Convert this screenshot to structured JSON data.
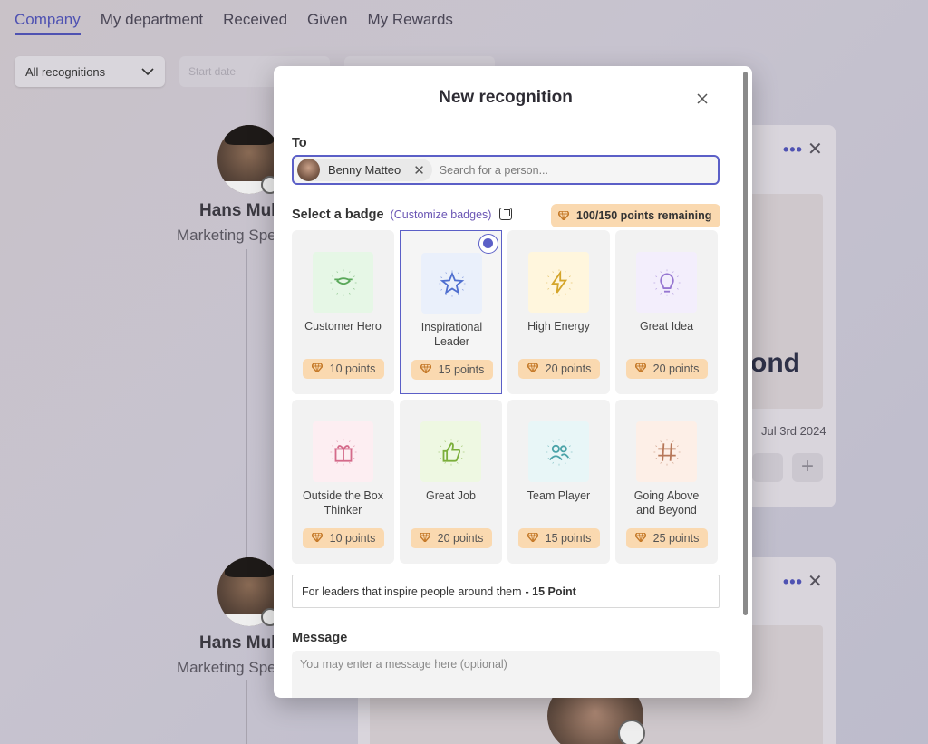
{
  "nav": {
    "tabs": [
      "Company",
      "My department",
      "Received",
      "Given",
      "My Rewards"
    ],
    "active_tab": "Company"
  },
  "filters": {
    "recognition_select": "All recognitions",
    "start_date_placeholder": "Start date"
  },
  "background_feed": {
    "people": [
      {
        "name": "Hans Mul",
        "role": "Marketing Spe"
      },
      {
        "name": "Hans Mul",
        "role": "Marketing Spe"
      }
    ],
    "card_date": "Jul 3rd 2024",
    "card_banner_fragment": "ond"
  },
  "modal": {
    "title": "New recognition",
    "to_label": "To",
    "recipient_chip": "Benny Matteo",
    "search_placeholder": "Search for a person...",
    "select_badge_label": "Select a badge",
    "customize_link": "(Customize badges)",
    "points_remaining": "100/150 points remaining",
    "badges": [
      {
        "name": "Customer Hero",
        "name2": "",
        "points": "10 points",
        "icon": "handshake-icon",
        "bg": "#e6f7e6",
        "color": "#5aa85a"
      },
      {
        "name": "Inspirational",
        "name2": "Leader",
        "points": "15 points",
        "icon": "star-icon",
        "bg": "#eaf0fb",
        "color": "#4f6fcf",
        "selected": true
      },
      {
        "name": "High Energy",
        "name2": "",
        "points": "20 points",
        "icon": "lightning-icon",
        "bg": "#fff6dd",
        "color": "#d4a52a"
      },
      {
        "name": "Great Idea",
        "name2": "",
        "points": "20 points",
        "icon": "lightbulb-icon",
        "bg": "#f3eefc",
        "color": "#9676d1"
      },
      {
        "name": "Outside the Box",
        "name2": "Thinker",
        "points": "10 points",
        "icon": "gift-box-icon",
        "bg": "#fdeef2",
        "color": "#d46a8a"
      },
      {
        "name": "Great Job",
        "name2": "",
        "points": "20 points",
        "icon": "thumbs-up-icon",
        "bg": "#eef8e2",
        "color": "#7caf3c"
      },
      {
        "name": "Team Player",
        "name2": "",
        "points": "15 points",
        "icon": "people-icon",
        "bg": "#e8f6f7",
        "color": "#4aa3a8"
      },
      {
        "name": "Going Above",
        "name2": "and Beyond",
        "points": "25 points",
        "icon": "hashtag-icon",
        "bg": "#fdefe7",
        "color": "#b7785a"
      }
    ],
    "description_text": "For leaders that inspire people around them",
    "description_points": "- 15 Point",
    "message_label": "Message",
    "message_placeholder": "You may enter a message here (optional)"
  }
}
